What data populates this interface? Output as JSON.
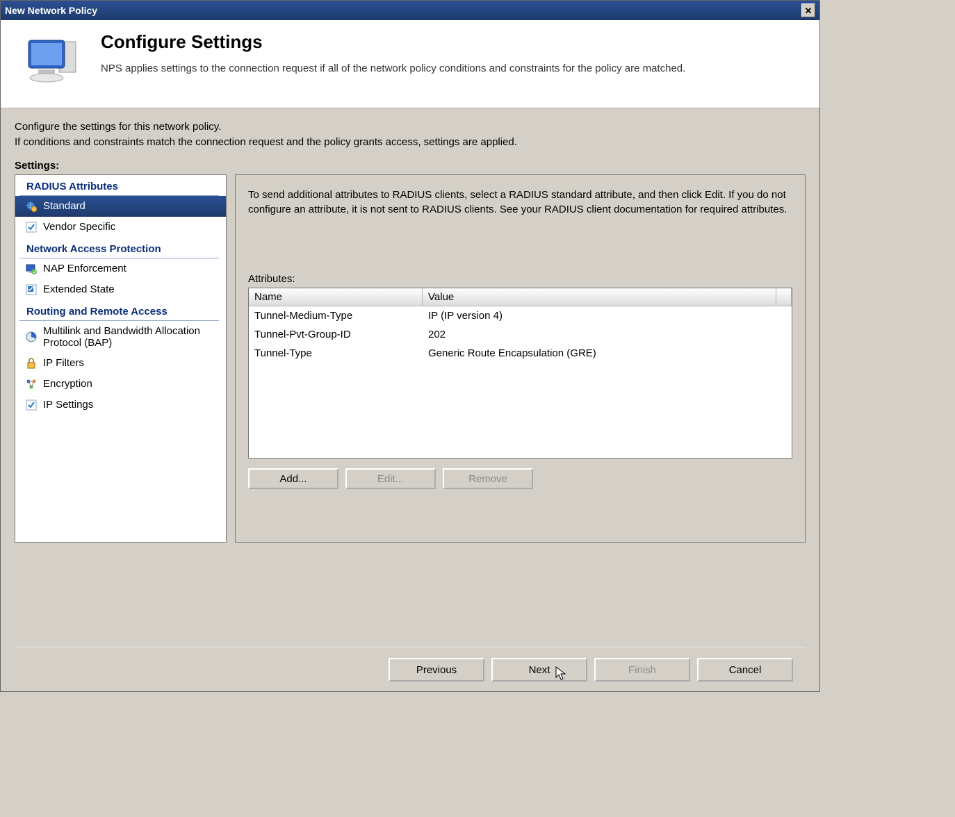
{
  "window": {
    "title": "New Network Policy"
  },
  "header": {
    "title": "Configure Settings",
    "subtitle": "NPS applies settings to the connection request if all of the network policy conditions and constraints for the policy are matched."
  },
  "intro": {
    "line1": "Configure the settings for this network policy.",
    "line2": "If conditions and constraints match the connection request and the policy grants access, settings are applied."
  },
  "settings_label": "Settings:",
  "categories": [
    {
      "title": "RADIUS Attributes",
      "items": [
        {
          "label": "Standard",
          "selected": true,
          "icon": "globe-gear-icon"
        },
        {
          "label": "Vendor Specific",
          "selected": false,
          "icon": "check-sheet-icon"
        }
      ]
    },
    {
      "title": "Network Access Protection",
      "items": [
        {
          "label": "NAP Enforcement",
          "selected": false,
          "icon": "monitor-check-icon"
        },
        {
          "label": "Extended State",
          "selected": false,
          "icon": "state-sheet-icon"
        }
      ]
    },
    {
      "title": "Routing and Remote Access",
      "items": [
        {
          "label": "Multilink and Bandwidth Allocation Protocol (BAP)",
          "selected": false,
          "icon": "pie-icon"
        },
        {
          "label": "IP Filters",
          "selected": false,
          "icon": "lock-icon"
        },
        {
          "label": "Encryption",
          "selected": false,
          "icon": "nodes-icon"
        },
        {
          "label": "IP Settings",
          "selected": false,
          "icon": "check-sheet-icon"
        }
      ]
    }
  ],
  "right": {
    "description": "To send additional attributes to RADIUS clients, select a RADIUS standard attribute, and then click Edit. If you do not configure an attribute, it is not sent to RADIUS clients. See your RADIUS client documentation for required attributes.",
    "attributes_label": "Attributes:",
    "columns": {
      "name": "Name",
      "value": "Value"
    },
    "rows": [
      {
        "name": "Tunnel-Medium-Type",
        "value": "IP (IP version 4)"
      },
      {
        "name": "Tunnel-Pvt-Group-ID",
        "value": "202"
      },
      {
        "name": "Tunnel-Type",
        "value": "Generic Route Encapsulation (GRE)"
      }
    ],
    "buttons": {
      "add": "Add...",
      "edit": "Edit...",
      "remove": "Remove"
    }
  },
  "footer": {
    "previous": "Previous",
    "next": "Next",
    "finish": "Finish",
    "cancel": "Cancel"
  }
}
